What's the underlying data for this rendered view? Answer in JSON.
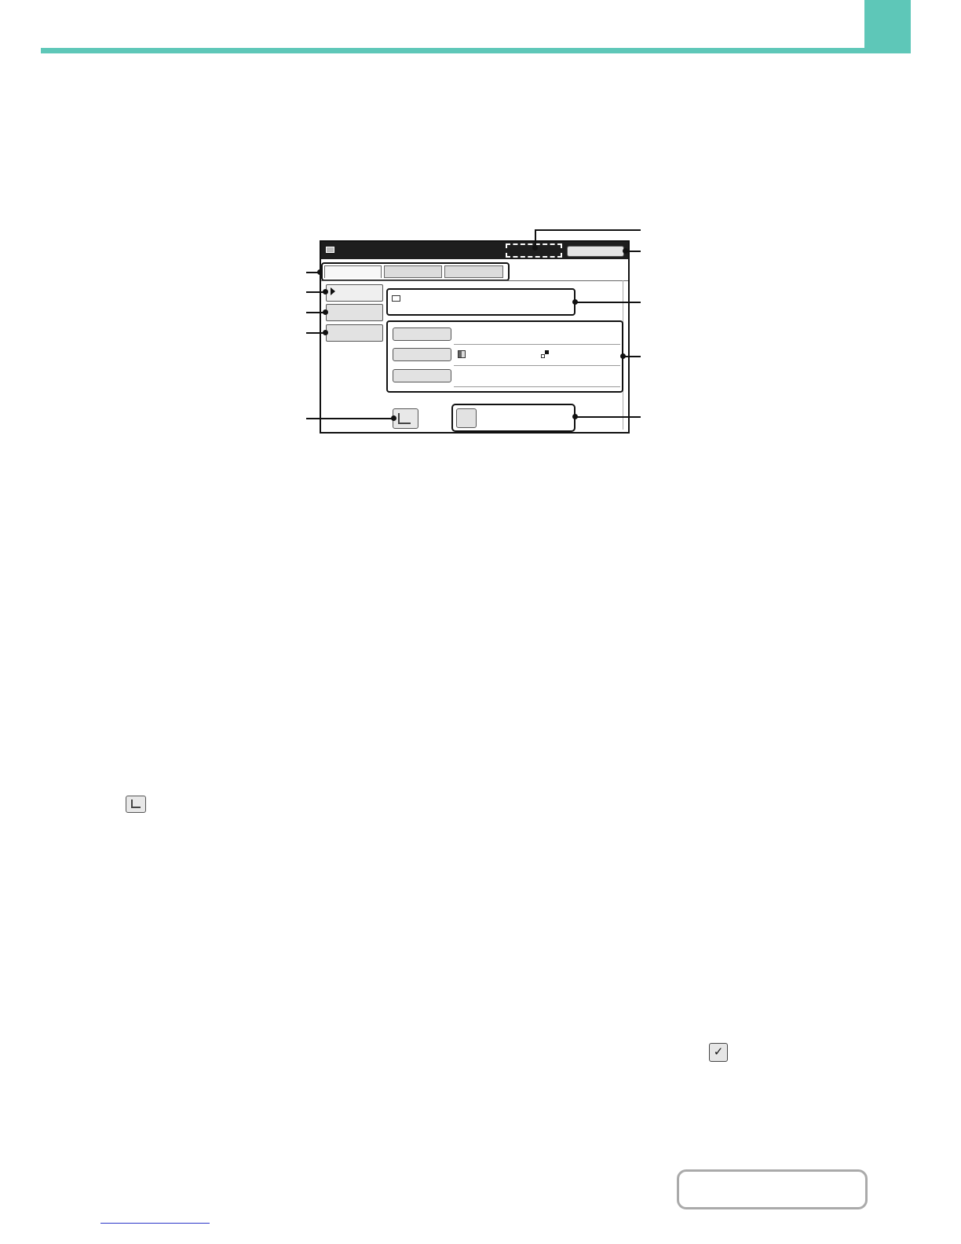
{
  "colors": {
    "accent": "#5ec7b8",
    "title_bar": "#1e1e1e",
    "button_face": "#e2e2e2",
    "contents_border": "#aaaaaa",
    "link": "#2b35c8"
  },
  "icons": {
    "title_icon": "mail-icon",
    "address_icon": "mail-edit-icon",
    "preview_icon": "preview-icon",
    "send_icon": "checkmark-icon",
    "inline_check": "checkmark-icon"
  },
  "inline": {
    "check_glyph": "✓"
  }
}
